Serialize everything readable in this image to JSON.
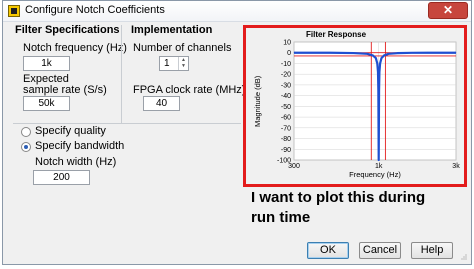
{
  "window": {
    "title": "Configure Notch Coefficients",
    "close_glyph": "✕"
  },
  "filter_specs": {
    "heading": "Filter Specifications",
    "notch_freq_label": "Notch frequency (Hz)",
    "notch_freq_value": "1k",
    "sample_rate_label_1": "Expected",
    "sample_rate_label_2": "sample rate (S/s)",
    "sample_rate_value": "50k",
    "specify_quality_label": "Specify quality",
    "specify_bandwidth_label": "Specify bandwidth",
    "selected_mode": "Specify bandwidth",
    "notch_width_label": "Notch width (Hz)",
    "notch_width_value": "200"
  },
  "implementation": {
    "heading": "Implementation",
    "channels_label": "Number of channels",
    "channels_value": "1",
    "fpga_label": "FPGA clock rate (MHz)",
    "fpga_value": "40"
  },
  "annotation": {
    "text": "I want to plot this during run time",
    "color": "#e31c1c"
  },
  "buttons": {
    "ok": "OK",
    "cancel": "Cancel",
    "help": "Help"
  },
  "chart_data": {
    "type": "line",
    "title": "Filter Response",
    "xlabel": "Frequency (Hz)",
    "ylabel": "Magnitude (dB)",
    "x_scale": "log",
    "xlim": [
      300,
      3000
    ],
    "ylim": [
      -100,
      10
    ],
    "x_ticks": [
      {
        "value": 300,
        "label": "300"
      },
      {
        "value": 1000,
        "label": "1k"
      },
      {
        "value": 3000,
        "label": "3k"
      }
    ],
    "y_ticks": [
      10,
      0,
      -10,
      -20,
      -30,
      -40,
      -50,
      -60,
      -70,
      -80,
      -90,
      -100
    ],
    "grid": true,
    "series": [
      {
        "color": "#1f4fd1",
        "x": [
          300,
          500,
          700,
          850,
          920,
          960,
          980,
          990,
          995,
          1000,
          1005,
          1010,
          1020,
          1040,
          1080,
          1150,
          1300,
          1600,
          2000,
          3000
        ],
        "y": [
          0,
          0,
          -0.3,
          -1.0,
          -2.5,
          -5,
          -10,
          -18,
          -35,
          -100,
          -35,
          -18,
          -10,
          -5,
          -2.5,
          -1.0,
          -0.4,
          -0.1,
          0,
          0
        ]
      }
    ],
    "reference_lines": {
      "color": "#e31c1c",
      "horizontal": [
        0,
        -3
      ],
      "vertical": [
        900,
        1100
      ]
    }
  }
}
